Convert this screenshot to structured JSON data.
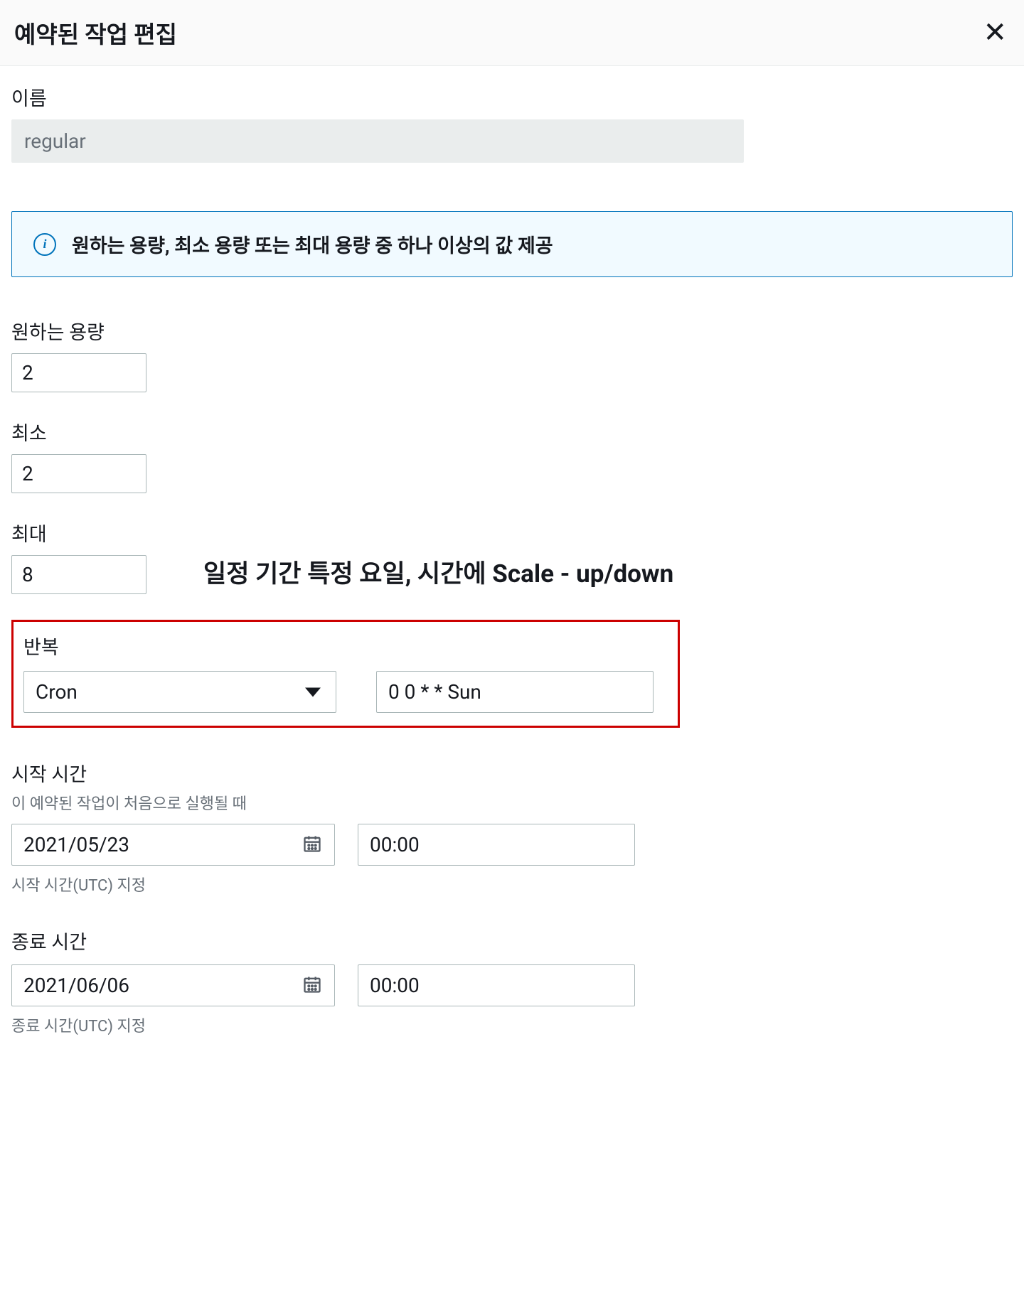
{
  "header": {
    "title": "예약된 작업 편집"
  },
  "name": {
    "label": "이름",
    "value": "regular"
  },
  "info": {
    "text": "원하는 용량, 최소 용량 또는 최대 용량 중 하나 이상의 값 제공"
  },
  "desired": {
    "label": "원하는 용량",
    "value": "2"
  },
  "min": {
    "label": "최소",
    "value": "2"
  },
  "max": {
    "label": "최대",
    "value": "8"
  },
  "annotation": "일정 기간 특정 요일, 시간에 Scale - up/down",
  "repeat": {
    "label": "반복",
    "selected": "Cron",
    "expression": "0 0 * * Sun"
  },
  "start": {
    "label": "시작 시간",
    "desc": "이 예약된 작업이 처음으로 실행될 때",
    "date": "2021/05/23",
    "time": "00:00",
    "footer": "시작 시간(UTC) 지정"
  },
  "end": {
    "label": "종료 시간",
    "date": "2021/06/06",
    "time": "00:00",
    "footer": "종료 시간(UTC) 지정"
  }
}
